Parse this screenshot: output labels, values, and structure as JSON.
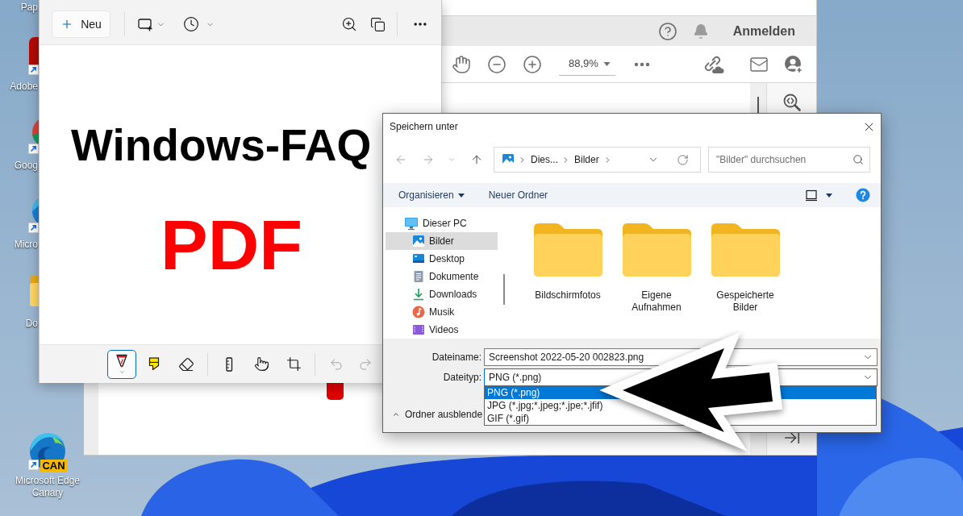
{
  "desktop_icons": [
    {
      "kind": "recycle-bin",
      "label": "Pap"
    },
    {
      "kind": "acrobat",
      "label": "Adobe"
    },
    {
      "kind": "chrome",
      "label": "Goog"
    },
    {
      "kind": "edge",
      "label": "Micro"
    },
    {
      "kind": "folder",
      "label": "Do"
    },
    {
      "kind": "edge-canary",
      "label": "Microsoft Edge Canary",
      "badge": "CAN"
    }
  ],
  "acrobat": {
    "sign_in": "Anmelden",
    "zoom": "88,9%"
  },
  "snipping_tool": {
    "new_button": "Neu",
    "heading": "Windows-FAQ",
    "subheading": "PDF",
    "tool_groups": [
      [
        {
          "kind": "ballpoint-pen",
          "selected": true
        },
        {
          "kind": "highlighter",
          "selected": false
        },
        {
          "kind": "eraser",
          "selected": false
        }
      ],
      [
        {
          "kind": "ruler",
          "selected": false
        },
        {
          "kind": "touch-writing",
          "selected": false
        },
        {
          "kind": "crop",
          "selected": false
        }
      ]
    ],
    "history": [
      {
        "kind": "undo",
        "disabled": true
      },
      {
        "kind": "redo",
        "disabled": true
      }
    ]
  },
  "save_dialog": {
    "title": "Speichern unter",
    "breadcrumbs": [
      "Dies...",
      "Bilder"
    ],
    "search": {
      "placeholder": "\"Bilder\" durchsuchen"
    },
    "organize": "Organisieren",
    "new_folder": "Neuer Ordner",
    "nav": [
      {
        "kind": "pc",
        "label": "Dieser PC",
        "selected": false,
        "children": [
          {
            "kind": "pictures",
            "label": "Bilder",
            "selected": true
          },
          {
            "kind": "desktop",
            "label": "Desktop",
            "selected": false
          },
          {
            "kind": "documents",
            "label": "Dokumente",
            "selected": false
          },
          {
            "kind": "downloads",
            "label": "Downloads",
            "selected": false
          },
          {
            "kind": "music",
            "label": "Musik",
            "selected": false
          },
          {
            "kind": "videos",
            "label": "Videos",
            "selected": false
          }
        ]
      }
    ],
    "folders": [
      {
        "label": "Bildschirmfotos"
      },
      {
        "label": "Eigene Aufnahmen"
      },
      {
        "label": "Gespeicherte Bilder"
      }
    ],
    "file_name": {
      "label": "Dateiname:",
      "value": "Screenshot 2022-05-20 002823.png"
    },
    "file_type": {
      "label": "Dateityp:",
      "value": "PNG (*.png)",
      "expanded": true,
      "options": [
        {
          "label": "PNG (*.png)",
          "selected": true
        },
        {
          "label": "JPG (*.jpg;*.jpeg;*.jpe;*.jfif)",
          "selected": false
        },
        {
          "label": "GIF (*.gif)",
          "selected": false
        }
      ]
    },
    "hide_folders": "Ordner ausblende"
  }
}
